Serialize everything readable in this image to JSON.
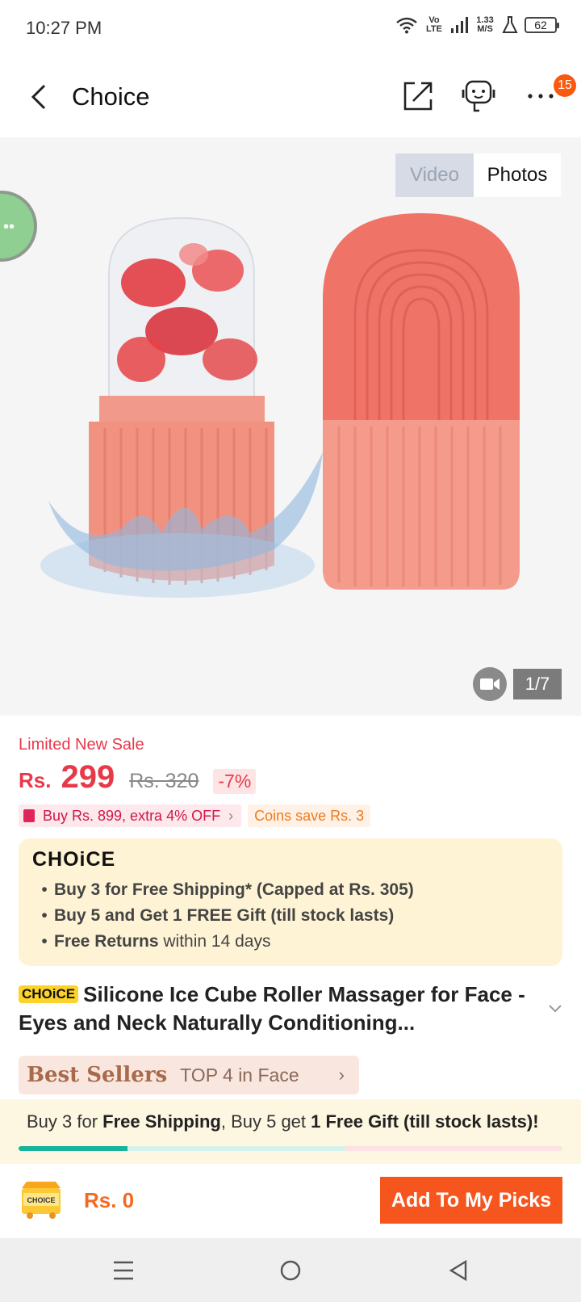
{
  "status_bar": {
    "time": "10:27 PM",
    "volte": "Vo LTE",
    "speed": "1.33 M/S",
    "battery": "62"
  },
  "header": {
    "title": "Choice",
    "notification_count": "15",
    "icons": [
      "back-icon",
      "share-icon",
      "support-icon",
      "more-icon"
    ]
  },
  "gallery": {
    "tabs": [
      "Video",
      "Photos"
    ],
    "active_tab": "Photos",
    "page_counter": "1/7"
  },
  "price": {
    "sale_label": "Limited New Sale",
    "currency": "Rs.",
    "current": "299",
    "original": "Rs. 320",
    "discount": "-7%"
  },
  "promos": {
    "coupon": "Buy Rs. 899, extra 4% OFF",
    "coins": "Coins save Rs. 3"
  },
  "choice": {
    "logo": "CHOiCE",
    "benefit_1": "Buy 3 for  Free Shipping* (Capped at Rs. 305)",
    "benefit_2": "Buy 5 and Get 1 FREE Gift (till stock lasts)",
    "benefit_3_bold": "Free Returns",
    "benefit_3_rest": " within 14 days"
  },
  "product": {
    "chip": "CHOiCE",
    "title": "Silicone Ice Cube Roller Massager for Face - Eyes and Neck Naturally Conditioning..."
  },
  "best_sellers": {
    "label": "Best Sellers",
    "rank": "TOP 4 in Face"
  },
  "shipping_banner": {
    "part1": "Buy 3 for ",
    "part2": "Free Shipping",
    "part3": ", Buy 5 get ",
    "part4": "1 Free Gift (till stock lasts)!",
    "progress": 0.2
  },
  "bottom_bar": {
    "cart_label": "CHOICE",
    "total": "Rs. 0",
    "add_button": "Add To My Picks"
  },
  "colors": {
    "accent_red": "#e8394a",
    "cta_orange": "#f7551e",
    "choice_yellow": "#fcd32a",
    "progress_teal": "#19b39a"
  }
}
